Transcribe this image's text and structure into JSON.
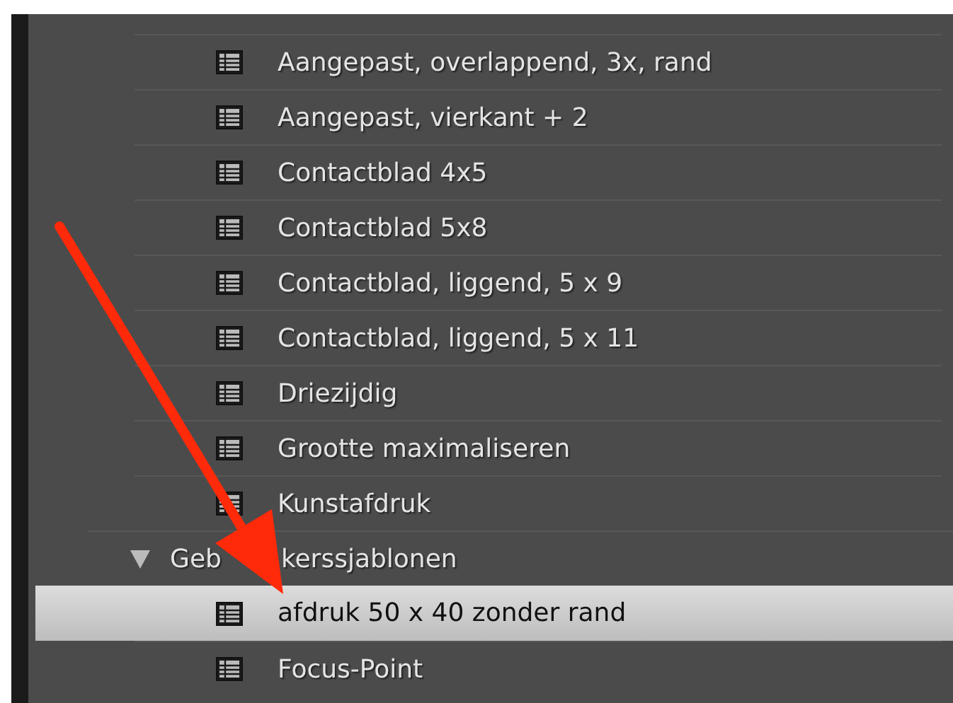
{
  "templates": [
    {
      "label": "Aangepast, overlappend, 3x, rand",
      "selected": false
    },
    {
      "label": "Aangepast, vierkant + 2",
      "selected": false
    },
    {
      "label": "Contactblad 4x5",
      "selected": false
    },
    {
      "label": "Contactblad 5x8",
      "selected": false
    },
    {
      "label": "Contactblad, liggend, 5 x 9",
      "selected": false
    },
    {
      "label": "Contactblad, liggend, 5 x 11",
      "selected": false
    },
    {
      "label": "Driezijdig",
      "selected": false
    },
    {
      "label": "Grootte maximaliseren",
      "selected": false
    },
    {
      "label": "Kunstafdruk",
      "selected": false
    }
  ],
  "folder": {
    "label_parts": [
      "Geb",
      "kerssjablonen"
    ],
    "expanded": true,
    "children": [
      {
        "label": "afdruk 50 x 40 zonder rand",
        "selected": true
      },
      {
        "label": "Focus-Point",
        "selected": false
      }
    ]
  }
}
